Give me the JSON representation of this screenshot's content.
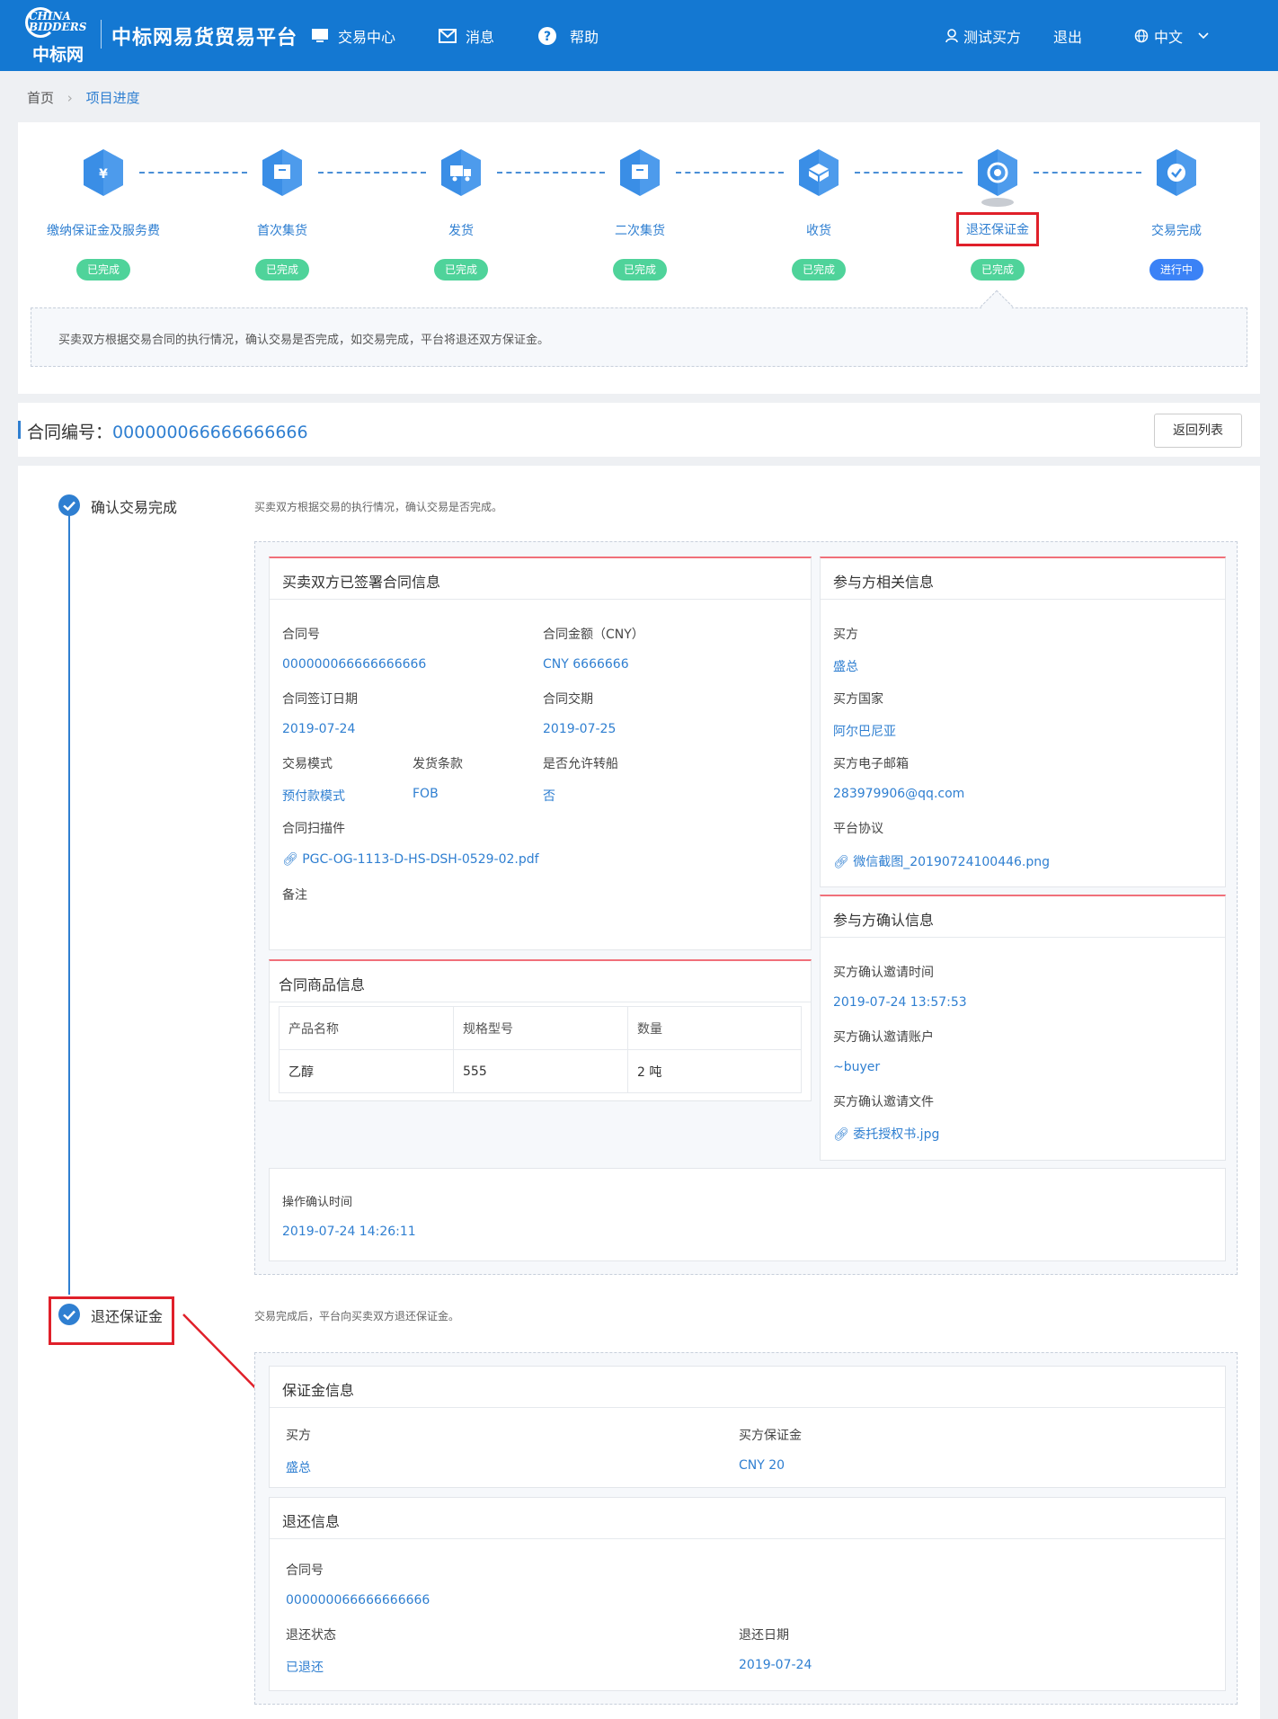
{
  "header": {
    "logo_text": "中标网",
    "logo_en": "CHINA BIDDERS",
    "brand": "中标网易货贸易平台",
    "nav": [
      "交易中心",
      "消息",
      "帮助"
    ],
    "user": "测试买方",
    "logout": "退出",
    "lang": "中文"
  },
  "breadcrumb": {
    "home": "首页",
    "current": "项目进度"
  },
  "steps": [
    {
      "label": "缴纳保证金及服务费",
      "status": "已完成",
      "icon": "shield-yuan-icon"
    },
    {
      "label": "首次集货",
      "status": "已完成",
      "icon": "box-icon"
    },
    {
      "label": "发货",
      "status": "已完成",
      "icon": "truck-icon"
    },
    {
      "label": "二次集货",
      "status": "已完成",
      "icon": "box-icon"
    },
    {
      "label": "收货",
      "status": "已完成",
      "icon": "package-icon"
    },
    {
      "label": "退还保证金",
      "status": "已完成",
      "icon": "refund-icon"
    },
    {
      "label": "交易完成",
      "status": "进行中",
      "icon": "check-icon"
    }
  ],
  "step_tip": "买卖双方根据交易合同的执行情况，确认交易是否完成，如交易完成，平台将退还双方保证金。",
  "contract": {
    "label": "合同编号：",
    "number": "000000066666666666",
    "return_btn": "返回列表"
  },
  "timeline": {
    "s1": {
      "title": "确认交易完成",
      "desc": "买卖双方根据交易的执行情况，确认交易是否完成。"
    },
    "s2": {
      "title": "退还保证金",
      "desc": "交易完成后，平台向买卖双方退还保证金。"
    }
  },
  "signed": {
    "title": "买卖双方已签署合同信息",
    "contract_no_lbl": "合同号",
    "contract_no": "000000066666666666",
    "amount_lbl": "合同金额（CNY）",
    "amount": "CNY 6666666",
    "sign_date_lbl": "合同签订日期",
    "sign_date": "2019-07-24",
    "delivery_lbl": "合同交期",
    "delivery": "2019-07-25",
    "mode_lbl": "交易模式",
    "mode": "预付款模式",
    "terms_lbl": "发货条款",
    "terms": "FOB",
    "transship_lbl": "是否允许转船",
    "transship": "否",
    "scan_lbl": "合同扫描件",
    "scan": "PGC-OG-1113-D-HS-DSH-0529-02.pdf",
    "remark_lbl": "备注"
  },
  "party": {
    "title": "参与方相关信息",
    "buyer_lbl": "买方",
    "buyer": "盛总",
    "country_lbl": "买方国家",
    "country": "阿尔巴尼亚",
    "email_lbl": "买方电子邮箱",
    "email": "283979906@qq.com",
    "agreement_lbl": "平台协议",
    "agreement": "微信截图_20190724100446.png"
  },
  "goods": {
    "title": "合同商品信息",
    "headers": [
      "产品名称",
      "规格型号",
      "数量"
    ],
    "row": [
      "乙醇",
      "555",
      "2  吨"
    ]
  },
  "confirm": {
    "title": "参与方确认信息",
    "time_lbl": "买方确认邀请时间",
    "time": "2019-07-24 13:57:53",
    "account_lbl": "买方确认邀请账户",
    "account": "~buyer",
    "file_lbl": "买方确认邀请文件",
    "file": "委托授权书.jpg"
  },
  "op": {
    "lbl": "操作确认时间",
    "time": "2019-07-24 14:26:11"
  },
  "deposit": {
    "title": "保证金信息",
    "buyer_lbl": "买方",
    "buyer": "盛总",
    "amount_lbl": "买方保证金",
    "amount": "CNY 20"
  },
  "refund": {
    "title": "退还信息",
    "no_lbl": "合同号",
    "no": "000000066666666666",
    "status_lbl": "退还状态",
    "status": "已退还",
    "date_lbl": "退还日期",
    "date": "2019-07-24"
  },
  "colors": {
    "primary": "#1478d2",
    "link": "#2f7fd1",
    "done": "#4fd39a",
    "active": "#3b82f6",
    "highlight": "#e0202a"
  }
}
